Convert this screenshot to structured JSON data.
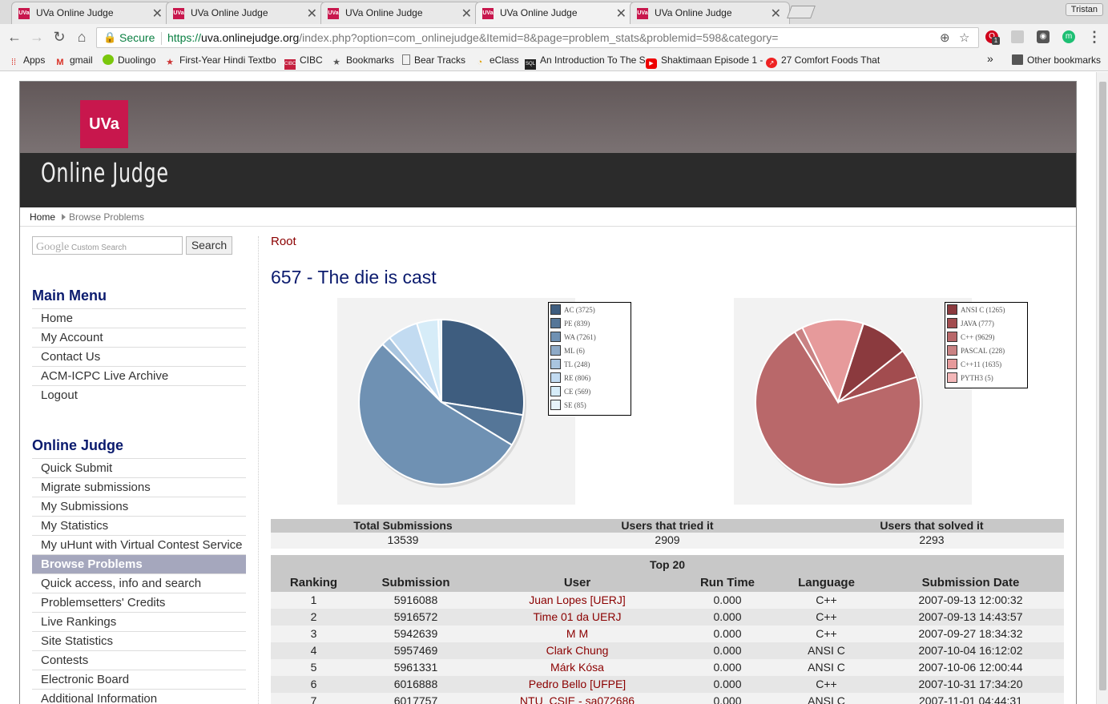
{
  "browser": {
    "tabs": [
      {
        "favicon": "UVa",
        "title": "UVa Online Judge"
      },
      {
        "favicon": "UVa",
        "title": "UVa Online Judge"
      },
      {
        "favicon": "UVa",
        "title": "UVa Online Judge"
      },
      {
        "favicon": "UVa",
        "title": "UVa Online Judge"
      },
      {
        "favicon": "UVa",
        "title": "UVa Online Judge"
      }
    ],
    "active_tab_index": 3,
    "tab_close_glyph": "✕",
    "profile_name": "Tristan",
    "secure_label": "Secure",
    "url_scheme": "https://",
    "url_domain": "uva.onlinejudge.org",
    "url_rest": "/index.php?option=com_onlinejudge&Itemid=8&page=problem_stats&problemid=598&category=",
    "extension_badge": "1",
    "extension_letter": "m",
    "bookmarks": [
      {
        "label": "Apps",
        "icon": "apps-grid-icon"
      },
      {
        "label": "gmail",
        "icon": "gmail-icon"
      },
      {
        "label": "Duolingo",
        "icon": "duolingo-icon"
      },
      {
        "label": "First-Year Hindi Textbo",
        "icon": "star-icon"
      },
      {
        "label": "CIBC",
        "icon": "cibc-icon"
      },
      {
        "label": "Bookmarks",
        "icon": "star-icon"
      },
      {
        "label": "Bear Tracks",
        "icon": "page-icon"
      },
      {
        "label": "eClass",
        "icon": "eclass-icon"
      },
      {
        "label": "An Introduction To The S",
        "icon": "sql-icon"
      },
      {
        "label": "Shaktimaan Episode 1 -",
        "icon": "youtube-icon"
      },
      {
        "label": "27 Comfort Foods That",
        "icon": "trending-icon"
      }
    ],
    "more_bookmarks_glyph": "»",
    "other_bookmarks": "Other bookmarks"
  },
  "header": {
    "logo_text": "UVa",
    "site_name": "Online Judge"
  },
  "breadcrumb": {
    "home": "Home",
    "current": "Browse Problems"
  },
  "search": {
    "placeholder_brand": "Google",
    "placeholder_text": "Custom Search",
    "button": "Search"
  },
  "main_menu": {
    "title": "Main Menu",
    "items": [
      "Home",
      "My Account",
      "Contact Us",
      "ACM-ICPC Live Archive",
      "Logout"
    ]
  },
  "oj_menu": {
    "title": "Online Judge",
    "items": [
      "Quick Submit",
      "Migrate submissions",
      "My Submissions",
      "My Statistics",
      "My uHunt with Virtual Contest Service",
      "Browse Problems",
      "Quick access, info and search",
      "Problemsetters' Credits",
      "Live Rankings",
      "Site Statistics",
      "Contests",
      "Electronic Board",
      "Additional Information"
    ],
    "selected_index": 5
  },
  "content": {
    "root": "Root",
    "problem_title": "657 - The die is cast"
  },
  "chart_data": [
    {
      "type": "pie",
      "title": "",
      "categories": [
        "AC",
        "PE",
        "WA",
        "ML",
        "TL",
        "RE",
        "CE",
        "SE"
      ],
      "values": [
        3725,
        839,
        7261,
        6,
        248,
        806,
        569,
        85
      ],
      "legend": [
        "AC (3725)",
        "PE (839)",
        "WA (7261)",
        "ML (6)",
        "TL (248)",
        "RE (806)",
        "CE (569)",
        "SE (85)"
      ],
      "colors": [
        "#3e5d7f",
        "#557698",
        "#6f91b3",
        "#8eaac7",
        "#a9c5df",
        "#c2dbf1",
        "#d6ecf8",
        "#e6f4fb"
      ],
      "legend_position": "top-right"
    },
    {
      "type": "pie",
      "title": "",
      "categories": [
        "ANSI C",
        "JAVA",
        "C++",
        "PASCAL",
        "C++11",
        "PYTH3"
      ],
      "values": [
        1265,
        777,
        9629,
        228,
        1635,
        5
      ],
      "legend": [
        "ANSI C (1265)",
        "JAVA (777)",
        "C++ (9629)",
        "PASCAL (228)",
        "C++11 (1635)",
        "PYTH3 (5)"
      ],
      "colors": [
        "#8b3a3e",
        "#a24c4f",
        "#b9686a",
        "#c98283",
        "#e69a9b",
        "#f3b7b8"
      ],
      "legend_position": "top-right"
    }
  ],
  "stats": {
    "headers": [
      "Total Submissions",
      "Users that tried it",
      "Users that solved it"
    ],
    "values": [
      "13539",
      "2909",
      "2293"
    ]
  },
  "top20": {
    "title": "Top 20",
    "columns": [
      "Ranking",
      "Submission",
      "User",
      "Run Time",
      "Language",
      "Submission Date"
    ],
    "rows": [
      [
        "1",
        "5916088",
        "Juan Lopes [UERJ]",
        "0.000",
        "C++",
        "2007-09-13 12:00:32"
      ],
      [
        "2",
        "5916572",
        "Time 01 da UERJ",
        "0.000",
        "C++",
        "2007-09-13 14:43:57"
      ],
      [
        "3",
        "5942639",
        "M M",
        "0.000",
        "C++",
        "2007-09-27 18:34:32"
      ],
      [
        "4",
        "5957469",
        "Clark Chung",
        "0.000",
        "ANSI C",
        "2007-10-04 16:12:02"
      ],
      [
        "5",
        "5961331",
        "Márk Kósa",
        "0.000",
        "ANSI C",
        "2007-10-06 12:00:44"
      ],
      [
        "6",
        "6016888",
        "Pedro Bello [UFPE]",
        "0.000",
        "C++",
        "2007-10-31 17:34:20"
      ],
      [
        "7",
        "6017757",
        "NTU_CSIE - sa072686",
        "0.000",
        "ANSI C",
        "2007-11-01 04:44:31"
      ]
    ]
  }
}
